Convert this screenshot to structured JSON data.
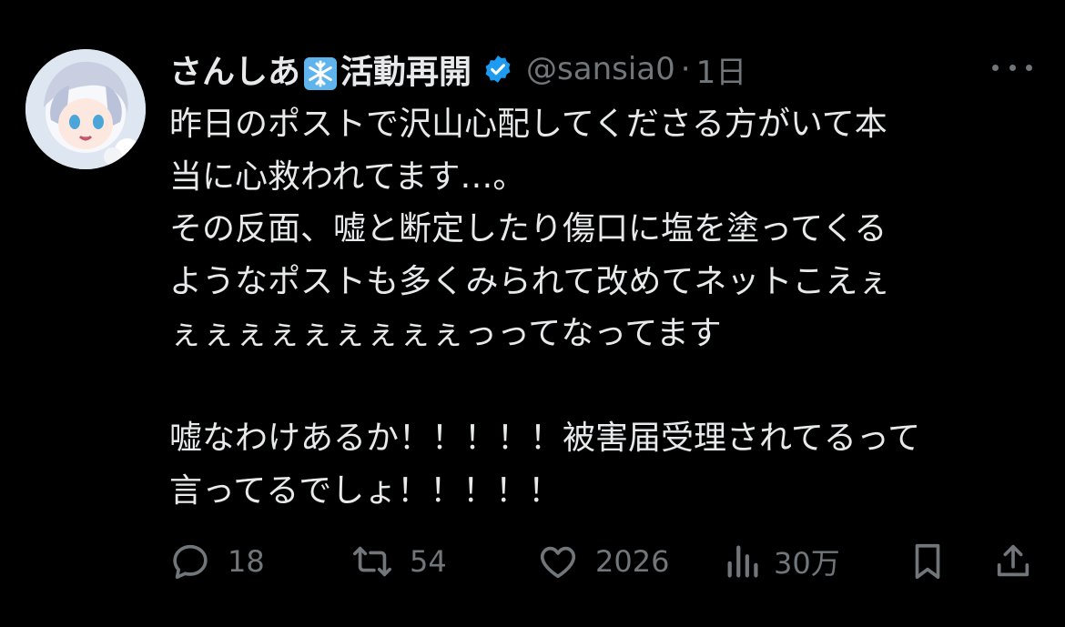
{
  "tweet": {
    "display_name_part1": "さんしあ",
    "display_name_part2": "活動再開",
    "handle": "@sansia0",
    "separator": "·",
    "time": "1日",
    "lines": [
      "昨日のポストで沢山心配してくださる方がいて本",
      "当に心救われてます…。",
      "その反面、嘘と断定したり傷口に塩を塗ってくる",
      "ようなポストも多くみられて改めてネットこえぇ",
      "ぇぇぇぇぇぇぇぇぇっってなってます",
      "",
      "嘘なわけあるか！！！！！被害届受理されてるって",
      "言ってるでしょ！！！！！"
    ]
  },
  "actions": {
    "reply_count": "18",
    "retweet_count": "54",
    "like_count": "2026",
    "views_count": "30万"
  },
  "icons": {
    "avatar": "avatar-anime-character",
    "snowflake": "snowflake-emoji",
    "verified": "verified-badge-icon",
    "more": "more-options-icon",
    "reply": "reply-icon",
    "retweet": "retweet-icon",
    "like": "heart-icon",
    "views": "views-chart-icon",
    "bookmark": "bookmark-icon",
    "share": "share-icon"
  },
  "colors": {
    "background": "#000000",
    "text": "#e7e9ea",
    "muted": "#71767b",
    "verified": "#1d9bf0"
  }
}
